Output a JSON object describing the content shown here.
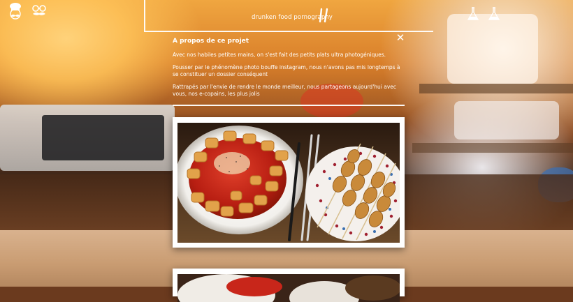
{
  "header": {
    "tagline": "drunken food pornography",
    "icons": [
      "chef-mustache-icon",
      "mustache-glasses-icon",
      "flask-icon",
      "erlenmeyer-flask-icon",
      "fork-knife-icon"
    ]
  },
  "about": {
    "title": "A propos de ce projet",
    "paragraphs": [
      "Avec nos habiles petites mains, on s'est fait des petits plats ultra photogéniques.",
      "Pousser par le phénomène photo bouffe instagram, nous n'avons pas mis longtemps à se constituer un dossier conséquent",
      "Rattrapés par l'envie de rendre le monde meilleur, nous partageons aujourd'hui avec vous, nos e-copains, les plus jolis"
    ]
  },
  "photos": [
    {
      "name": "gnocchi-and-skewers-photo"
    },
    {
      "name": "second-food-photo"
    }
  ],
  "colors": {
    "text": "#ffffff",
    "frame": "#ffffff",
    "card": "#ffffff",
    "sauce": "#c8261a"
  }
}
